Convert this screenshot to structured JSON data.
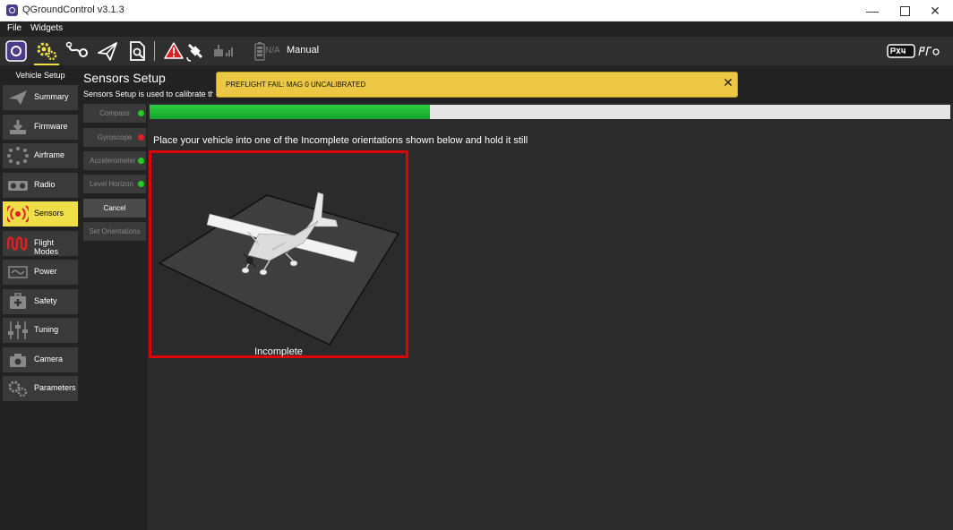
{
  "window": {
    "title": "QGroundControl v3.1.3",
    "minimize": "—",
    "close": "✕"
  },
  "menu": {
    "file": "File",
    "widgets": "Widgets"
  },
  "toolbar": {
    "battery_na": "N/A",
    "flight_mode": "Manual",
    "logo_text": "PX4 pro"
  },
  "nav": {
    "header": "Vehicle Setup",
    "items": [
      {
        "label": "Summary",
        "icon": "paper-plane-icon"
      },
      {
        "label": "Firmware",
        "icon": "download-icon"
      },
      {
        "label": "Airframe",
        "icon": "airframe-icon"
      },
      {
        "label": "Radio",
        "icon": "radio-icon"
      },
      {
        "label": "Sensors",
        "icon": "sensors-icon"
      },
      {
        "label": "Flight Modes",
        "icon": "wave-icon"
      },
      {
        "label": "Power",
        "icon": "power-icon"
      },
      {
        "label": "Safety",
        "icon": "first-aid-icon"
      },
      {
        "label": "Tuning",
        "icon": "sliders-icon"
      },
      {
        "label": "Camera",
        "icon": "camera-icon"
      },
      {
        "label": "Parameters",
        "icon": "gears-icon"
      }
    ],
    "active": "Sensors"
  },
  "page": {
    "title": "Sensors Setup",
    "description": "Sensors Setup is used to calibrate the sensors"
  },
  "sensors": {
    "compass": "Compass",
    "gyroscope": "Gyroscope",
    "accelerometer": "Accelerometer",
    "level_horizon": "Level Horizon",
    "cancel": "Cancel",
    "set_orientations": "Set Orientations"
  },
  "status_colors": {
    "ok": "#22cc22",
    "fail": "#e02020"
  },
  "calibration": {
    "progress": 0.35,
    "instruction": "Place your vehicle into one of the Incomplete orientations shown below and hold it still",
    "orientation_label": "Incomplete"
  },
  "alert": {
    "message": "PREFLIGHT FAIL: MAG 0 UNCALIBRATED",
    "close": "✕"
  },
  "colors": {
    "accent": "#f0de48",
    "alert_bg": "#ecc744",
    "incomplete_border": "#e00000"
  }
}
